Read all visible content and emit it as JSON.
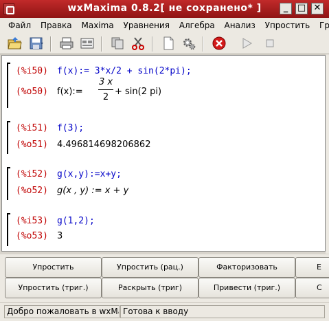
{
  "window": {
    "title": "wxMaxima 0.8.2[ не сохранено* ]",
    "minimize": "_",
    "maximize": "□",
    "close": "✕"
  },
  "menu": [
    "Файл",
    "Правка",
    "Maxima",
    "Уравнения",
    "Алгебра",
    "Анализ",
    "Упростить",
    "Графики"
  ],
  "toolbar": [
    "open-file-icon",
    "save-file-icon",
    "print-icon",
    "preferences-icon",
    "copy-icon",
    "cut-icon",
    "select-all-icon",
    "configure-icon",
    "interrupt-icon",
    "animation-start-icon",
    "animation-stop-icon"
  ],
  "cells": [
    {
      "in_label": "(%i50)",
      "input": "f(x):= 3*x/2 + sin(2*pi);",
      "out_label": "(%o50)",
      "out_prefix": "f(x):=",
      "frac_num": "3 x",
      "frac_den": "2",
      "out_suffix": "+ sin(2 pi)"
    },
    {
      "in_label": "(%i51)",
      "input": "f(3);",
      "out_label": "(%o51)",
      "output": "4.496814698206862"
    },
    {
      "in_label": "(%i52)",
      "input": "g(x,y):=x+y;",
      "out_label": "(%o52)",
      "output": "g(x , y) := x + y"
    },
    {
      "in_label": "(%i53)",
      "input": "g(1,2);",
      "out_label": "(%o53)",
      "output": "3"
    }
  ],
  "buttons": {
    "row1": [
      "Упростить",
      "Упростить (рац.)",
      "Факторизовать",
      "Е"
    ],
    "row2": [
      "Упростить (триг.)",
      "Раскрыть (триг)",
      "Привести (триг.)",
      "С"
    ]
  },
  "status": {
    "left": "Добро пожаловать в wxMa",
    "right": "Готова к вводу"
  },
  "colors": {
    "titlebar": "#a51f1f",
    "input_label": "#c00000",
    "input_text": "#0000c8"
  }
}
